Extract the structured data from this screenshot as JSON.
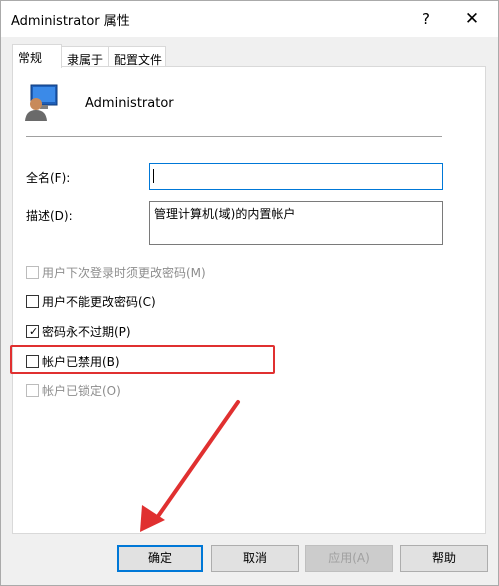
{
  "window": {
    "title": "Administrator 属性",
    "help": "?",
    "close": "✕"
  },
  "tabs": [
    {
      "label": "常规"
    },
    {
      "label": "隶属于"
    },
    {
      "label": "配置文件"
    }
  ],
  "user": {
    "name": "Administrator"
  },
  "fields": {
    "fullname_label": "全名(F):",
    "fullname_value": "",
    "description_label": "描述(D):",
    "description_value": "管理计算机(域)的内置帐户"
  },
  "checkboxes": [
    {
      "label": "用户下次登录时须更改密码(M)",
      "checked": false,
      "enabled": false
    },
    {
      "label": "用户不能更改密码(C)",
      "checked": false,
      "enabled": true
    },
    {
      "label": "密码永不过期(P)",
      "checked": true,
      "enabled": true
    },
    {
      "label": "帐户已禁用(B)",
      "checked": false,
      "enabled": true
    },
    {
      "label": "帐户已锁定(O)",
      "checked": false,
      "enabled": false
    }
  ],
  "buttons": {
    "ok": "确定",
    "cancel": "取消",
    "apply": "应用(A)",
    "help": "帮助"
  },
  "colors": {
    "highlight": "#e03030",
    "arrow": "#e03030",
    "focus": "#0078d7"
  }
}
